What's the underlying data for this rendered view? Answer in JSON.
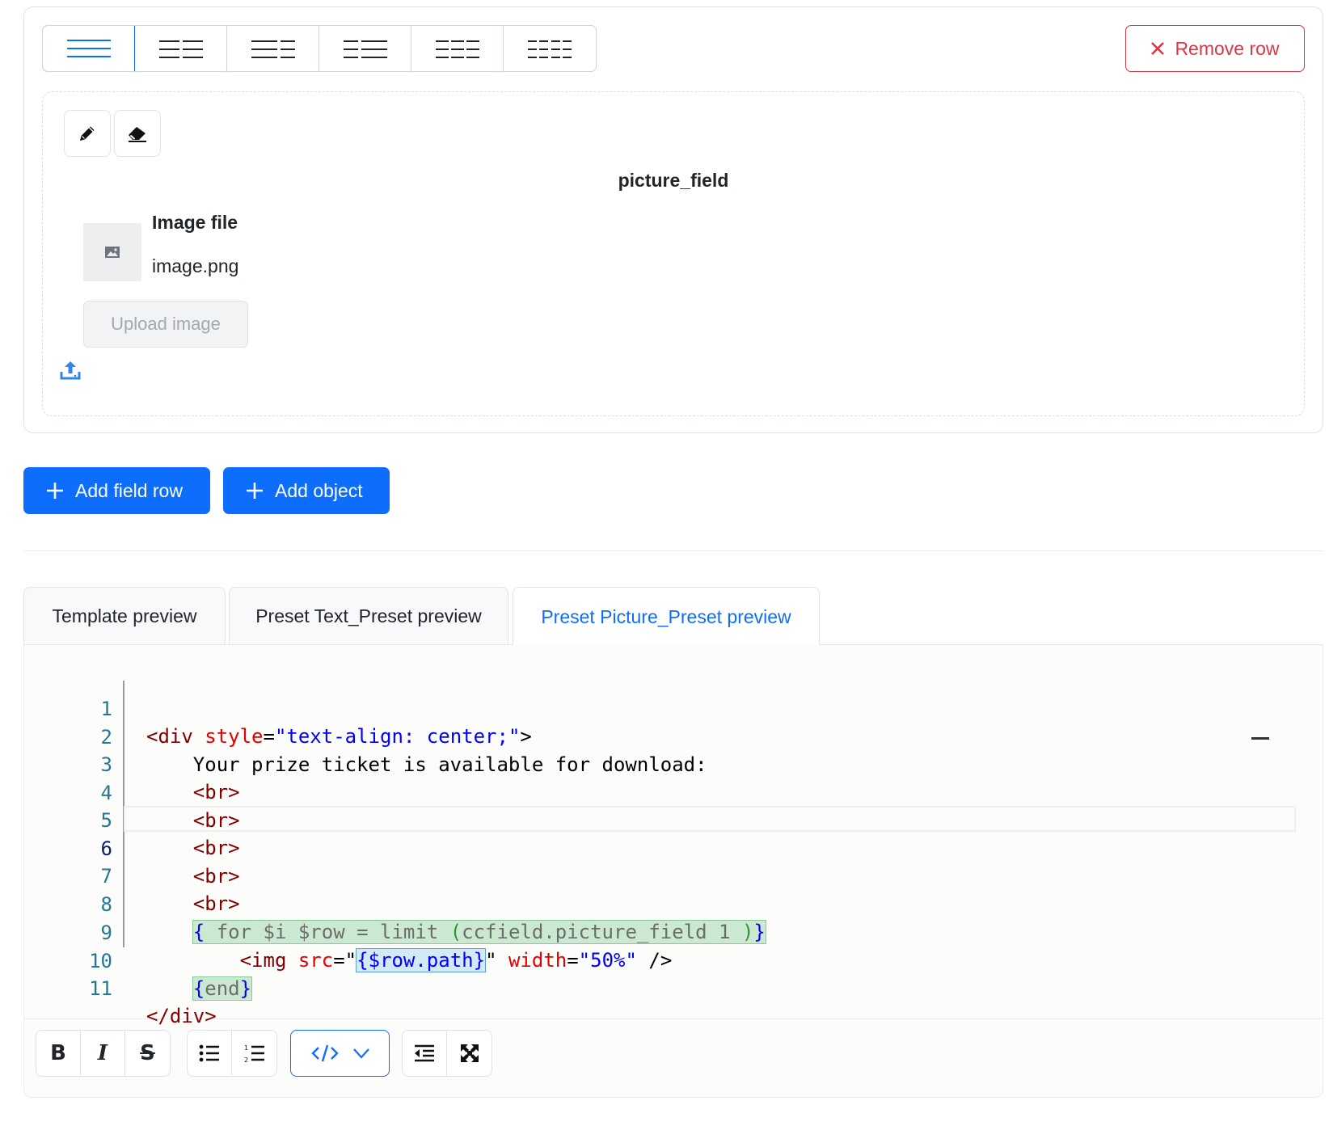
{
  "row_card": {
    "remove_label": "Remove row",
    "field": {
      "title": "picture_field",
      "image_label": "Image file",
      "image_name": "image.png",
      "upload_label": "Upload image"
    }
  },
  "actions": {
    "add_field_row": "Add field row",
    "add_object": "Add object"
  },
  "tabs": [
    {
      "label": "Template preview"
    },
    {
      "label": "Preset Text_Preset preview"
    },
    {
      "label": "Preset Picture_Preset preview",
      "active": true
    }
  ],
  "editor": {
    "current_line": 6,
    "lines": [
      {
        "n": "1"
      },
      {
        "n": "2"
      },
      {
        "n": "3"
      },
      {
        "n": "4"
      },
      {
        "n": "5"
      },
      {
        "n": "6"
      },
      {
        "n": "7"
      },
      {
        "n": "8"
      },
      {
        "n": "9"
      },
      {
        "n": "10"
      },
      {
        "n": "11"
      }
    ],
    "tokens": {
      "l1": [
        "<div",
        "style",
        "=",
        "\"text-align: center;\"",
        ">"
      ],
      "l2": "Your prize ticket is available for download:",
      "br": "<br>",
      "l8": [
        "{",
        "for $i $row = limit",
        "(",
        "ccfield.picture_field 1",
        ")",
        "}"
      ],
      "l9": [
        "<img",
        "src",
        "=\"",
        "{",
        "$row.path",
        "}",
        "\"",
        "width",
        "=",
        "\"50%\"",
        "/>"
      ],
      "l10": [
        "{",
        "end",
        "}"
      ],
      "l11": "</div>"
    }
  },
  "colors": {
    "primary": "#0d6efd",
    "danger": "#dc3545",
    "line_number": "#237893",
    "tag": "#800000",
    "attribute": "#e50000",
    "attr_value": "#0000ff"
  },
  "icons": {
    "layout": "layout-columns-icon",
    "edit": "pencil-icon",
    "clear": "eraser-icon",
    "image": "image-icon",
    "upload": "upload-icon",
    "add": "plus-icon",
    "bold": "bold-icon",
    "italic": "italic-icon",
    "strike": "strikethrough-icon",
    "bullets": "bullet-list-icon",
    "numbers": "numbered-list-icon",
    "code": "code-icon",
    "outdent": "outdent-icon",
    "fullscreen": "fullscreen-icon"
  }
}
